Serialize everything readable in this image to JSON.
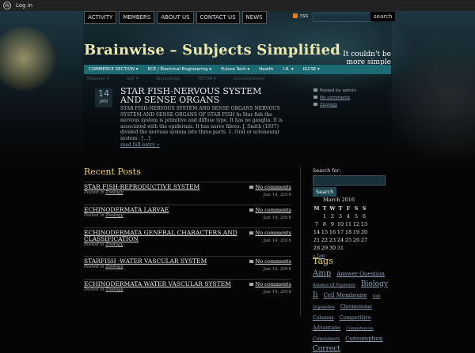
{
  "admin_bar": {
    "login": "Log in"
  },
  "nav": [
    "ACTIVITY",
    "MEMBERS",
    "ABOUT US",
    "CONTACT US",
    "NEWS"
  ],
  "top_search": {
    "rss": "rss",
    "button": "search"
  },
  "site": {
    "title": "Brainwise – Subjects Simplified",
    "tagline": "It couldn't be more simple"
  },
  "menu": [
    "COMMERCE SECTION ▾",
    "ECE / Electrical Engineering ▾",
    "Future Tech ▾",
    "Health",
    "I.R. ▾",
    "IGCSE ▾"
  ],
  "submenu": [
    "Museum ▾",
    "SAT ▾",
    "Technology",
    "TETON ▾",
    "Uncategorised"
  ],
  "post": {
    "day": "14",
    "month": "JAN",
    "title": "STAR FISH-NERVOUS SYSTEM AND SENSE ORGANS",
    "excerpt": "STAR FISH-NERVOUS SYSTEM AND SENSE ORGANS NERVOUS SYSTEM AND SENSE ORGANS OF STAR FISH In Star fish the nervous system is primitive and diffuse type. It has no ganglia. It is associated with the epidermis. It has nerve fibres. J. Smith (1937) divided the nervous system into three parts. 1. Oral or ectoneural system : […]",
    "read_more": "read full entry »",
    "posted_by": "Posted by admin",
    "comments": "No comments",
    "category": "Zoology"
  },
  "recent": {
    "heading": "Recent Posts",
    "posted_in": "Posted in",
    "category": "Zoology",
    "comments": "No comments",
    "items": [
      {
        "title": "STAR FISH-REPRODUCTIVE SYSTEM",
        "date": "Jan 14, 2016"
      },
      {
        "title": "ECHINODERMATA LARVAE",
        "date": "Jan 14, 2016"
      },
      {
        "title": "ECHINODERMATA GENERAL CHARACTERS AND CLASSIFICATION",
        "date": "Jan 14, 2016"
      },
      {
        "title": "STARFISH -WATER VASCULAR SYSTEM",
        "date": "Jan 14, 2016"
      },
      {
        "title": "ECHINODERMATA WATER VASCULAR SYSTEM",
        "date": "Jan 14, 2016"
      }
    ]
  },
  "sidebar": {
    "search_label": "Search for:",
    "search_button": "Search",
    "calendar": {
      "caption": "March 2016",
      "weekdays": [
        "M",
        "T",
        "W",
        "T",
        "F",
        "S",
        "S"
      ],
      "rows": [
        [
          "",
          "1",
          "2",
          "3",
          "4",
          "5",
          "6"
        ],
        [
          "7",
          "8",
          "9",
          "10",
          "11",
          "12",
          "13"
        ],
        [
          "14",
          "15",
          "16",
          "17",
          "18",
          "19",
          "20"
        ],
        [
          "21",
          "22",
          "23",
          "24",
          "25",
          "26",
          "27"
        ],
        [
          "28",
          "29",
          "30",
          "31",
          "",
          "",
          ""
        ]
      ],
      "prev": "« Jan"
    },
    "tags_heading": "Tags",
    "tags": [
      {
        "text": "Amp",
        "size": 10
      },
      {
        "text": "Answer Question",
        "size": 7
      },
      {
        "text": "Balance Of Payments",
        "size": 5
      },
      {
        "text": "Biology Ii",
        "size": 9
      },
      {
        "text": "Cell Membrane",
        "size": 7
      },
      {
        "text": "Cell Organelles",
        "size": 5
      },
      {
        "text": "Chromosome",
        "size": 6
      },
      {
        "text": "Columns",
        "size": 6
      },
      {
        "text": "Competitive Advantage",
        "size": 6.5
      },
      {
        "text": "Competences",
        "size": 5
      },
      {
        "text": "Consumers",
        "size": 6
      },
      {
        "text": "Consumption",
        "size": 7
      },
      {
        "text": "Correct",
        "size": 9
      }
    ]
  },
  "colors": {
    "menu_bar": "#1c6a73",
    "title": "#ede9ae",
    "heading": "#f0d36c",
    "link": "#8fa3b8"
  }
}
